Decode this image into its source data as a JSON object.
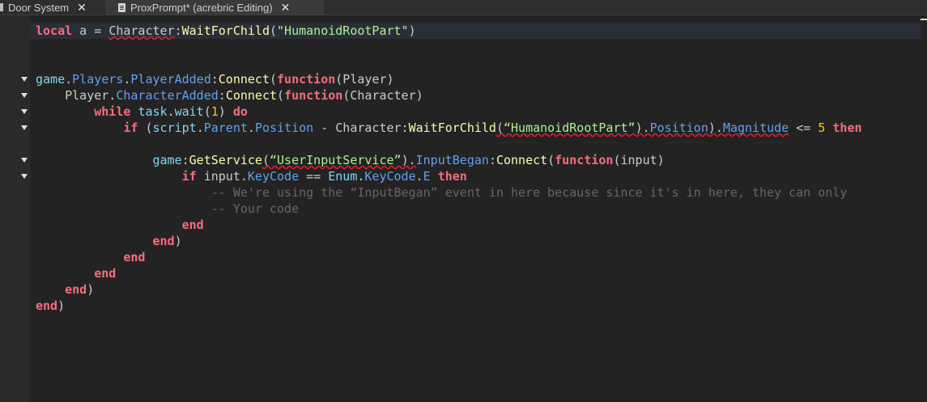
{
  "tabs": [
    {
      "label": "Door System",
      "close": "✕"
    },
    {
      "label": "ProxPrompt* (acrebric Editing)",
      "close": "✕"
    }
  ],
  "code": {
    "line1": {
      "t1": "local",
      "t2": " a = ",
      "t3": "Character",
      "t4": ":",
      "t5": "WaitForChild",
      "t6": "(",
      "t7": "\"HumanoidRootPart\"",
      "t8": ")"
    },
    "line4": {
      "t1": "game",
      "t2": ".",
      "t3": "Players",
      "t4": ".",
      "t5": "PlayerAdded",
      "t6": ":",
      "t7": "Connect",
      "t8": "(",
      "t9": "function",
      "t10": "(Player)"
    },
    "line5": {
      "t1": "    Player.",
      "t2": "CharacterAdded",
      "t3": ":",
      "t4": "Connect",
      "t5": "(",
      "t6": "function",
      "t7": "(Character)"
    },
    "line6": {
      "t1": "        ",
      "t2": "while",
      "t3": " ",
      "t4": "task",
      "t5": ".",
      "t6": "wait",
      "t7": "(",
      "t8": "1",
      "t9": ") ",
      "t10": "do"
    },
    "line7": {
      "t1": "            ",
      "t2": "if",
      "t3": " (",
      "t4": "script",
      "t5": ".",
      "t6": "Parent",
      "t7": ".",
      "t8": "Position",
      "t9": " - Character:",
      "t10": "WaitForChild",
      "t11": "(",
      "t12": "“HumanoidRootPart”",
      "t13": ").",
      "t14": "Position",
      "t15": ").",
      "t16": "Magnitude",
      "t17": " <= ",
      "t18": "5",
      "t19": " ",
      "t20": "then"
    },
    "line9": {
      "t1": "                ",
      "t2": "game",
      "t3": ":",
      "t4": "GetService",
      "t5": "(",
      "t6": "“UserInputService”",
      "t7": ").",
      "t8": "InputBegan",
      "t9": ":",
      "t10": "Connect",
      "t11": "(",
      "t12": "function",
      "t13": "(input)"
    },
    "line10": {
      "t1": "                    ",
      "t2": "if",
      "t3": " input.",
      "t4": "KeyCode",
      "t5": " == ",
      "t6": "Enum",
      "t7": ".",
      "t8": "KeyCode",
      "t9": ".",
      "t10": "E",
      "t11": " ",
      "t12": "then"
    },
    "line11": "                        -- We're using the “InputBegan” event in here because since it's in here, they can only",
    "line12": "                        -- Your code",
    "line13": {
      "t1": "                    ",
      "t2": "end"
    },
    "line14": {
      "t1": "                ",
      "t2": "end",
      "t3": ")"
    },
    "line15": {
      "t1": "            ",
      "t2": "end"
    },
    "line16": {
      "t1": "        ",
      "t2": "end"
    },
    "line17": {
      "t1": "    ",
      "t2": "end",
      "t3": ")"
    },
    "line18": {
      "t1": "end",
      "t2": ")"
    }
  },
  "colors": {
    "keyword": "#f86d7c",
    "builtin": "#84d6f7",
    "function": "#fdfbac",
    "string": "#adf195",
    "number": "#ffc600",
    "property": "#61a1f1",
    "comment": "#666666",
    "background": "#232323"
  },
  "icons": [
    "door-icon",
    "script-icon",
    "close-icon",
    "fold-arrow-icon"
  ]
}
